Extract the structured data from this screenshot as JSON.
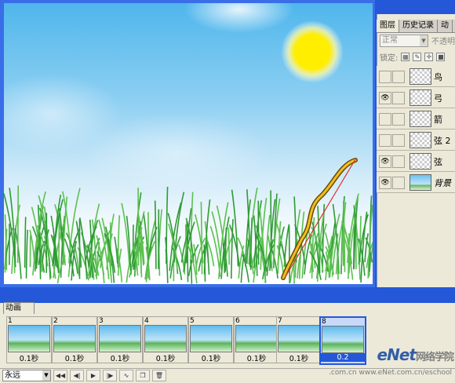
{
  "layers_panel": {
    "tabs": [
      "图层",
      "历史记录",
      "动"
    ],
    "blend_mode": "正常",
    "opacity_label": "不透明",
    "lock_label": "锁定:",
    "layers": [
      {
        "name": "鸟",
        "visible": false,
        "italic": false
      },
      {
        "name": "弓",
        "visible": true,
        "italic": false
      },
      {
        "name": "箭",
        "visible": false,
        "italic": false
      },
      {
        "name": "弦 2",
        "visible": false,
        "italic": false
      },
      {
        "name": "弦",
        "visible": true,
        "italic": false
      },
      {
        "name": "背景",
        "visible": true,
        "italic": true
      }
    ]
  },
  "animation_panel": {
    "tab_label": "动画",
    "frames": [
      {
        "number": "1",
        "delay": "0.1秒"
      },
      {
        "number": "2",
        "delay": "0.1秒"
      },
      {
        "number": "3",
        "delay": "0.1秒"
      },
      {
        "number": "4",
        "delay": "0.1秒"
      },
      {
        "number": "5",
        "delay": "0.1秒"
      },
      {
        "number": "6",
        "delay": "0.1秒"
      },
      {
        "number": "7",
        "delay": "0.1秒"
      },
      {
        "number": "8",
        "delay": "0.2"
      }
    ],
    "selected_frame": 8,
    "loop_option": "永远",
    "controls": [
      "first-frame-icon",
      "prev-frame-icon",
      "play-icon",
      "next-frame-icon",
      "tween-icon",
      "new-frame-icon",
      "delete-frame-icon"
    ]
  },
  "watermark": {
    "logo": "eNet",
    "cn_text": "网络学院",
    "domain": ".com.cn",
    "url": "www.eNet.com.cn/eschool"
  },
  "colors": {
    "sun": "#ffee00",
    "bow": "#f0c020",
    "bowstring": "#e03030",
    "grass": "#3aa83a",
    "selection": "#2458d8"
  }
}
